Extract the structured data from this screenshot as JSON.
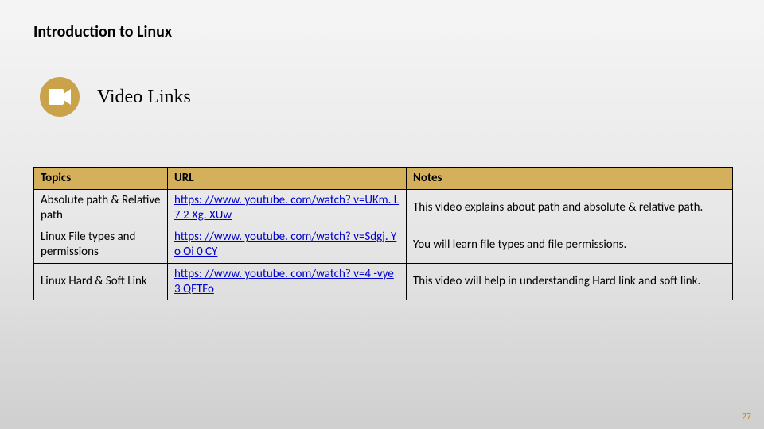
{
  "page_title": "Introduction to Linux",
  "section_title": "Video Links",
  "slide_number": "27",
  "colors": {
    "accent": "#c9a24a",
    "header_bg": "#d4af5c",
    "link": "#0000cc",
    "slide_number": "#c78a1f"
  },
  "table": {
    "headers": {
      "topics": "Topics",
      "url": "URL",
      "notes": "Notes"
    },
    "rows": [
      {
        "topic": "Absolute path & Relative path",
        "url": "https: //www. youtube. com/watch? v=UKm. L 7 2 Xg. XUw",
        "notes": "This video explains about path and absolute & relative path."
      },
      {
        "topic": "Linux File types and permissions",
        "url": "https: //www. youtube. com/watch? v=Sdgj. Yo Oi 0 CY",
        "notes": "You will learn file types and file permissions."
      },
      {
        "topic": "Linux Hard & Soft Link",
        "url": "https: //www. youtube. com/watch? v=4 -vye 3 QFTFo",
        "notes": "This video will help in understanding Hard link and soft link."
      }
    ]
  }
}
